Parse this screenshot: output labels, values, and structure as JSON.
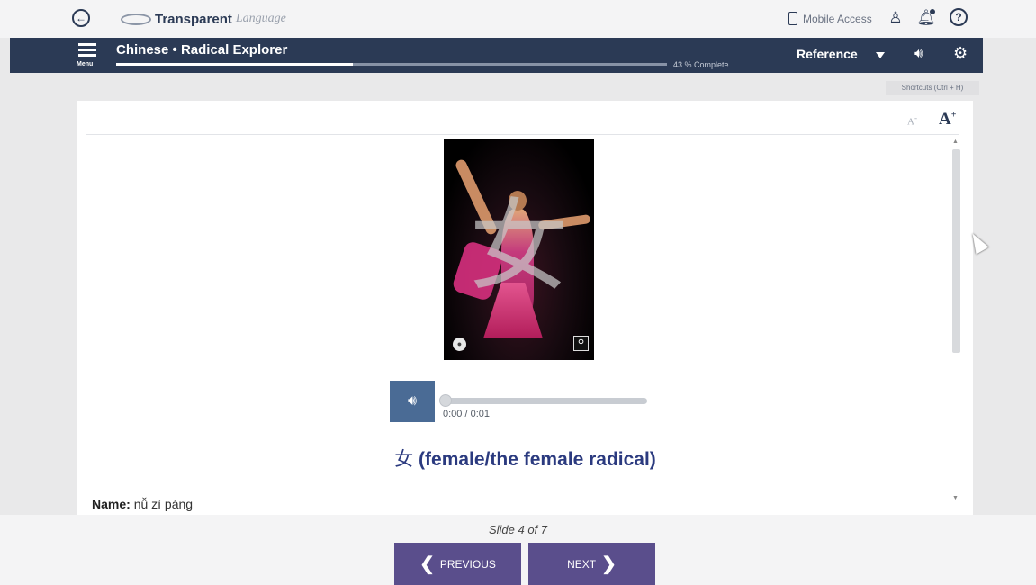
{
  "brand": {
    "name": "Transparent",
    "suffix": "Language",
    "mobile_access": "Mobile Access",
    "help_glyph": "?"
  },
  "lesson": {
    "title": "Chinese • Radical Explorer",
    "progress_percent": 43,
    "progress_label": "43 % Complete",
    "menu_label": "Menu",
    "reference_label": "Reference"
  },
  "shortcuts_label": "Shortcuts (Ctrl + H)",
  "font_controls": {
    "decrease": "A",
    "increase": "A"
  },
  "photo": {
    "overlay_char": "女"
  },
  "audio": {
    "time": "0:00 / 0:01",
    "progress_fraction": 0
  },
  "headword": {
    "character": "女",
    "meaning": "(female/the female radical)"
  },
  "details": {
    "name_label": "Name:",
    "name_value": "nǚ zì páng"
  },
  "navigation": {
    "slide_label": "Slide 4 of 7",
    "previous": "PREVIOUS",
    "next": "NEXT"
  },
  "colors": {
    "navy": "#2b3a55",
    "purple": "#5a4e8c",
    "audio_blue": "#4a6b95",
    "headword": "#2b3a7f"
  }
}
